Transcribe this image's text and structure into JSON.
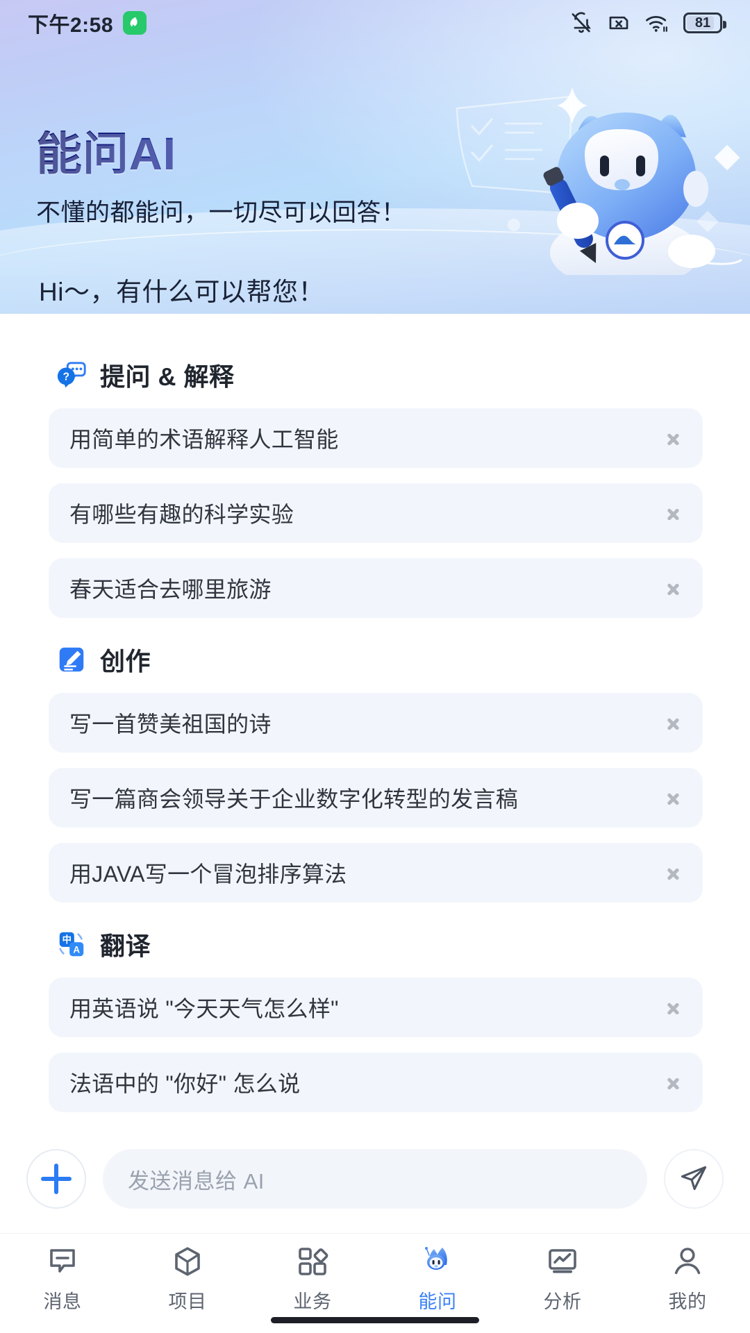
{
  "status_bar": {
    "time": "下午2:58",
    "leaf_icon": "leaf-icon",
    "mute_icon": "bell-off-icon",
    "sim_icon": "sim-card-x-icon",
    "wifi_icon": "wifi-icon",
    "battery_icon": "battery-icon",
    "battery_level": "81"
  },
  "hero": {
    "title": "能问AI",
    "subtitle": "不懂的都能问，一切尽可以回答！",
    "mascot_icon": "robot-mascot-icon",
    "accent_color": "#2746e0",
    "bg_color": "#bcd6fa"
  },
  "greeting": "Hi～，有什么可以帮您！",
  "sections": [
    {
      "icon": "question-chat-icon",
      "title": "提问 & 解释",
      "items": [
        "用简单的术语解释人工智能",
        "有哪些有趣的科学实验",
        "春天适合去哪里旅游"
      ]
    },
    {
      "icon": "edit-pencil-icon",
      "title": "创作",
      "items": [
        "写一首赞美祖国的诗",
        "写一篇商会领导关于企业数字化转型的发言稿",
        "用JAVA写一个冒泡排序算法"
      ]
    },
    {
      "icon": "translate-icon",
      "title": "翻译",
      "items": [
        "用英语说 \"今天天气怎么样\"",
        "法语中的 \"你好\" 怎么说"
      ]
    }
  ],
  "input_bar": {
    "add_icon": "plus-icon",
    "placeholder": "发送消息给 AI",
    "value": "",
    "send_icon": "send-paper-plane-icon"
  },
  "tabs": [
    {
      "label": "消息",
      "icon": "message-bubble-icon",
      "active": false
    },
    {
      "label": "项目",
      "icon": "cube-icon",
      "active": false
    },
    {
      "label": "业务",
      "icon": "grid-diamond-icon",
      "active": false
    },
    {
      "label": "能问",
      "icon": "robot-mascot-icon",
      "active": true
    },
    {
      "label": "分析",
      "icon": "chart-monitor-icon",
      "active": false
    },
    {
      "label": "我的",
      "icon": "person-icon",
      "active": false
    }
  ],
  "tab_active_color": "#3b82f6"
}
